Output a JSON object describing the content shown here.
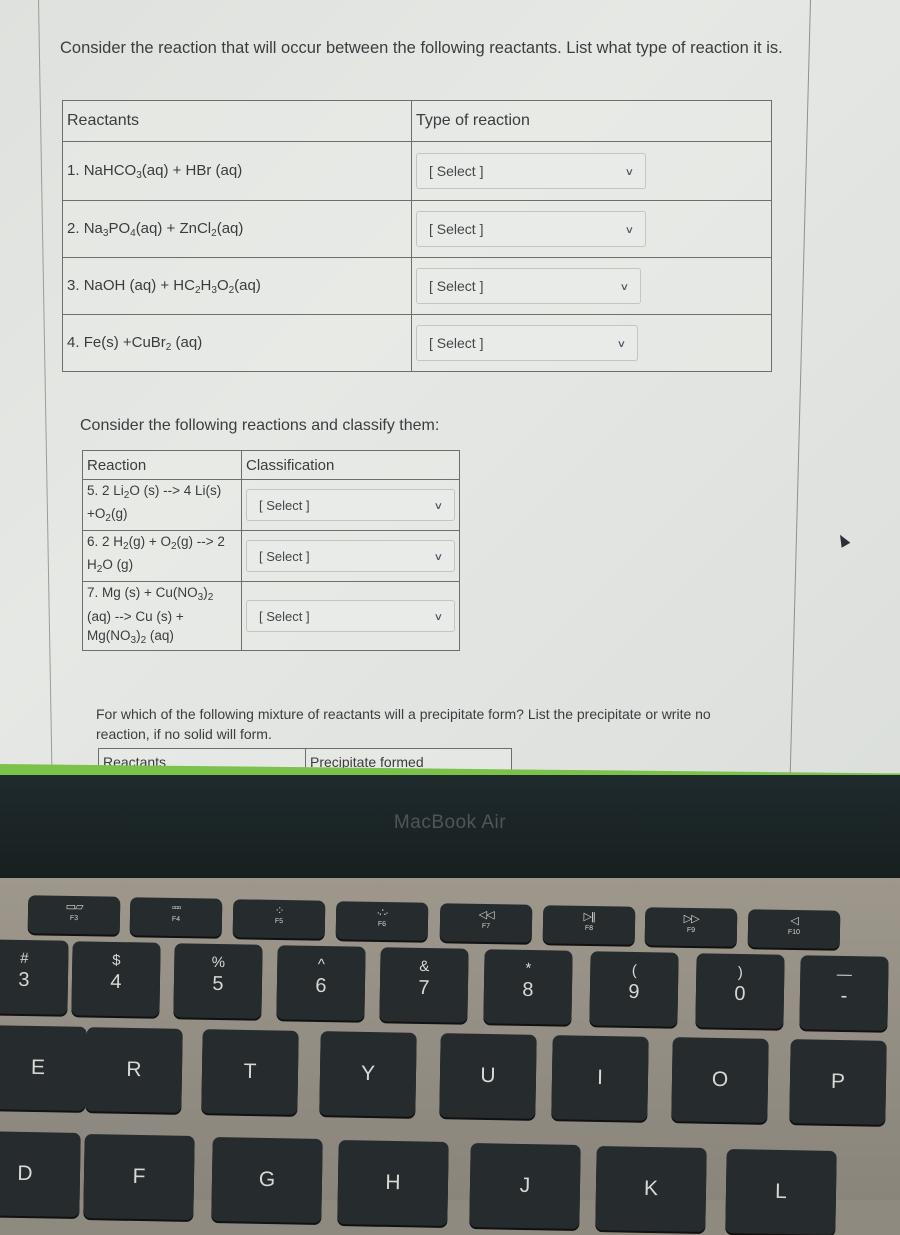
{
  "section1": {
    "prompt": "Consider the reaction that will occur between the following reactants. List what type of reaction it is.",
    "headers": {
      "reactants": "Reactants",
      "type": "Type of reaction"
    },
    "rows": [
      {
        "num": "1.",
        "parts": [
          "NaHCO",
          "3",
          "(aq) + HBr (aq)"
        ],
        "select": "[ Select ]"
      },
      {
        "num": "2.",
        "parts": [
          "Na",
          "3",
          "PO",
          "4",
          "(aq) + ZnCl",
          "2",
          "(aq)"
        ],
        "select": "[ Select ]"
      },
      {
        "num": "3.",
        "parts": [
          "NaOH (aq) + HC",
          "2",
          "H",
          "3",
          "O",
          "2",
          "(aq)"
        ],
        "select": "[ Select ]"
      },
      {
        "num": "4.",
        "parts": [
          "Fe(s) +CuBr",
          "2",
          " (aq)"
        ],
        "select": "[ Select ]"
      }
    ]
  },
  "section2": {
    "prompt": "Consider the following reactions and classify them:",
    "headers": {
      "reaction": "Reaction",
      "classification": "Classification"
    },
    "rows": [
      {
        "num": "5.",
        "parts": [
          "2 Li",
          "2",
          "O (s) --> 4 Li(s) +O",
          "2",
          "(g)"
        ],
        "select": "[ Select ]"
      },
      {
        "num": "6.",
        "parts": [
          "2 H",
          "2",
          "(g) + O",
          "2",
          "(g) --> 2 H",
          "2",
          "O (g)"
        ],
        "select": "[ Select ]"
      },
      {
        "num": "7.",
        "parts": [
          "Mg (s) + Cu(NO",
          "3",
          ")",
          "2",
          " (aq) --> Cu (s) + Mg(NO",
          "3",
          ")",
          "2",
          " (aq)"
        ],
        "select": "[ Select ]"
      }
    ]
  },
  "section3": {
    "prompt": "For which of the following mixture of reactants will a precipitate form? List the precipitate or write no reaction, if no solid will form.",
    "headers": {
      "reactants": "Reactants",
      "precipitate": "Precipitate formed"
    }
  },
  "device": {
    "brand": "MacBook Air"
  },
  "keyboard": {
    "function_row": [
      {
        "label": "F3",
        "icon": "mission-control-icon",
        "glyph": "▭▱"
      },
      {
        "label": "F4",
        "icon": "launchpad-icon",
        "glyph": "▫▫▫"
      },
      {
        "label": "F5",
        "icon": "keyboard-brightness-down-icon",
        "glyph": "·:·"
      },
      {
        "label": "F6",
        "icon": "keyboard-brightness-up-icon",
        "glyph": "·∴·"
      },
      {
        "label": "F7",
        "icon": "rewind-icon",
        "glyph": "◁◁"
      },
      {
        "label": "F8",
        "icon": "play-pause-icon",
        "glyph": "▷||"
      },
      {
        "label": "F9",
        "icon": "fast-forward-icon",
        "glyph": "▷▷"
      },
      {
        "label": "F10",
        "icon": "mute-icon",
        "glyph": "◁"
      }
    ],
    "number_row": [
      {
        "top": "#",
        "bottom": "3"
      },
      {
        "top": "$",
        "bottom": "4"
      },
      {
        "top": "%",
        "bottom": "5"
      },
      {
        "top": "^",
        "bottom": "6"
      },
      {
        "top": "&",
        "bottom": "7"
      },
      {
        "top": "*",
        "bottom": "8"
      },
      {
        "top": "(",
        "bottom": "9"
      },
      {
        "top": ")",
        "bottom": "0"
      },
      {
        "top": "—",
        "bottom": "-"
      }
    ],
    "qwerty_row": [
      "E",
      "R",
      "T",
      "Y",
      "U",
      "I",
      "O",
      "P"
    ],
    "home_row": [
      "D",
      "F",
      "G",
      "H",
      "J",
      "K",
      "L"
    ]
  }
}
